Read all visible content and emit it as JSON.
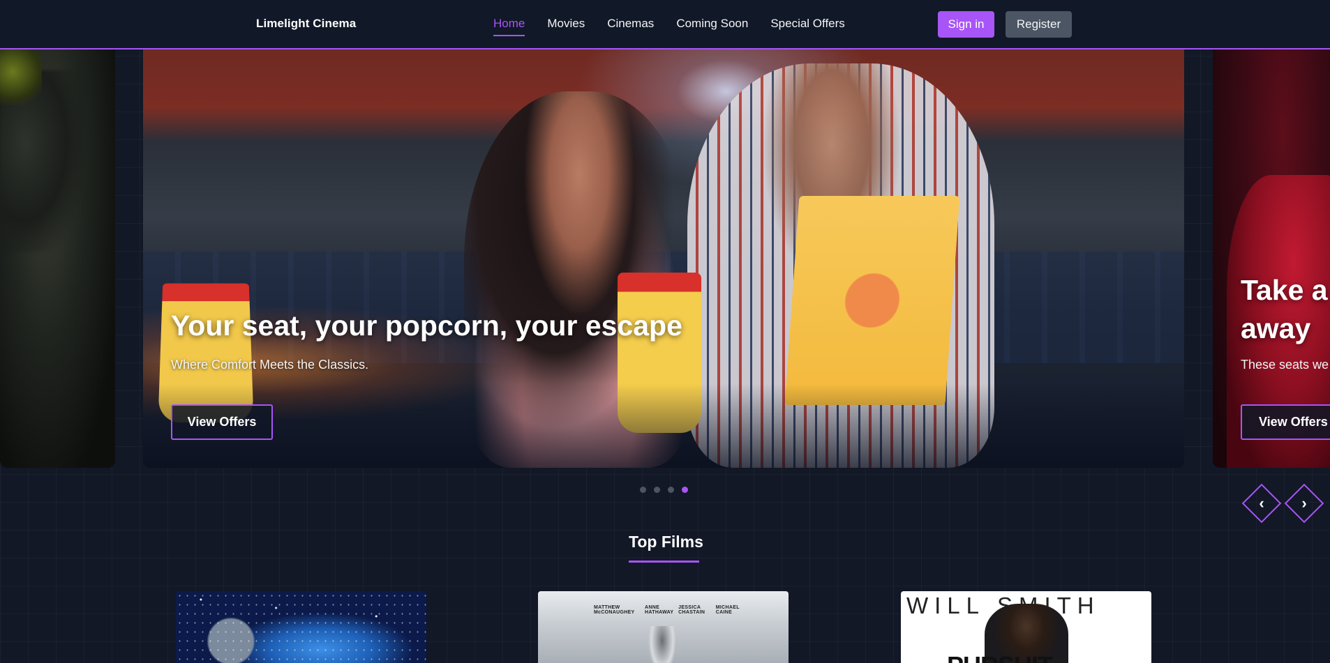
{
  "brand": "Limelight Cinema",
  "nav": {
    "links": [
      "Home",
      "Movies",
      "Cinemas",
      "Coming Soon",
      "Special Offers"
    ],
    "active": "Home"
  },
  "auth": {
    "signin_label": "Sign in",
    "register_label": "Register"
  },
  "carousel": {
    "current_slide": {
      "title": "Your seat, your popcorn, your escape",
      "subtitle": "Where Comfort Meets the Classics.",
      "button_label": "View Offers"
    },
    "next_slide": {
      "title_line1": "Take a",
      "title_line2": "away",
      "subtitle": "These seats we",
      "button_label": "View Offers"
    },
    "dots_count": 4,
    "active_dot": 4
  },
  "top_films": {
    "heading": "Top Films",
    "posters": [
      {
        "name": "film-poster-1"
      },
      {
        "name": "film-poster-2",
        "credits": [
          "MATTHEW McCONAUGHEY",
          "ANNE HATHAWAY",
          "JESSICA CHASTAIN",
          "MICHAEL CAINE"
        ]
      },
      {
        "name": "film-poster-3",
        "headline": "WILL SMITH",
        "title_fragment": "PURSUIT"
      }
    ]
  },
  "colors": {
    "accent": "#a855f7",
    "background": "#121826",
    "navbar": "#111827",
    "register_button": "#4b5563"
  }
}
